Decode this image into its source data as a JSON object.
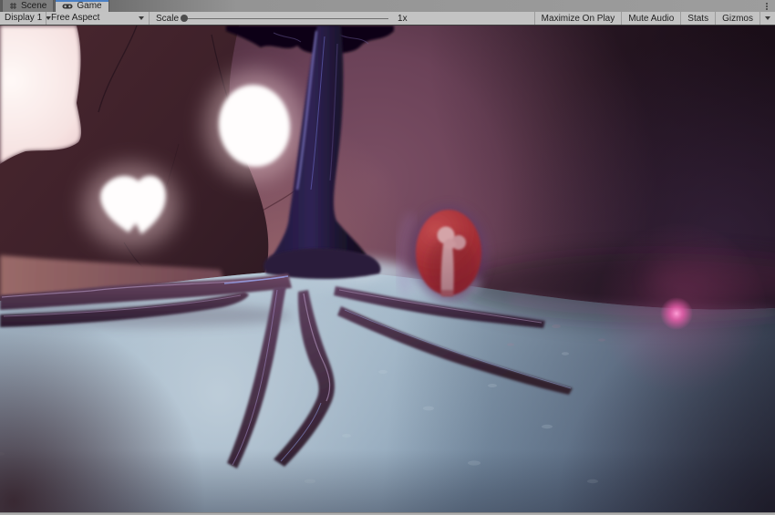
{
  "tabs": [
    {
      "label": "Scene",
      "icon": "grid-icon",
      "active": false
    },
    {
      "label": "Game",
      "icon": "gamepad-icon",
      "active": true
    }
  ],
  "toolbar": {
    "display_dropdown": "Display 1",
    "aspect_dropdown": "Free Aspect",
    "scale_label": "Scale",
    "scale_value": "1x",
    "buttons": [
      "Maximize On Play",
      "Mute Audio",
      "Stats",
      "Gizmos"
    ]
  },
  "colors": {
    "active_tab_accent": "#4a7fc4",
    "toolbar_bg": "#c3c3c3",
    "tab_text": "#1d1d1d",
    "scene_rock": "#3c2029",
    "scene_wall": "#6d4358",
    "scene_floor": "#9db3c5",
    "scene_root": "#4f3556",
    "scene_shrine_red": "#a12f33",
    "scene_bone": "#c89aa0",
    "scene_eye_glow": "#fffdfd",
    "scene_corner_light": "#f8e6e4",
    "scene_pink_glow": "#f060b0"
  },
  "scene": {
    "objects": [
      "skull-rock",
      "eye-hole-round",
      "eye-hole-heart",
      "corner-backlight",
      "root-tree",
      "root-tendrils",
      "bone-shrine",
      "bone",
      "pink-glow",
      "cavern-floor"
    ]
  }
}
